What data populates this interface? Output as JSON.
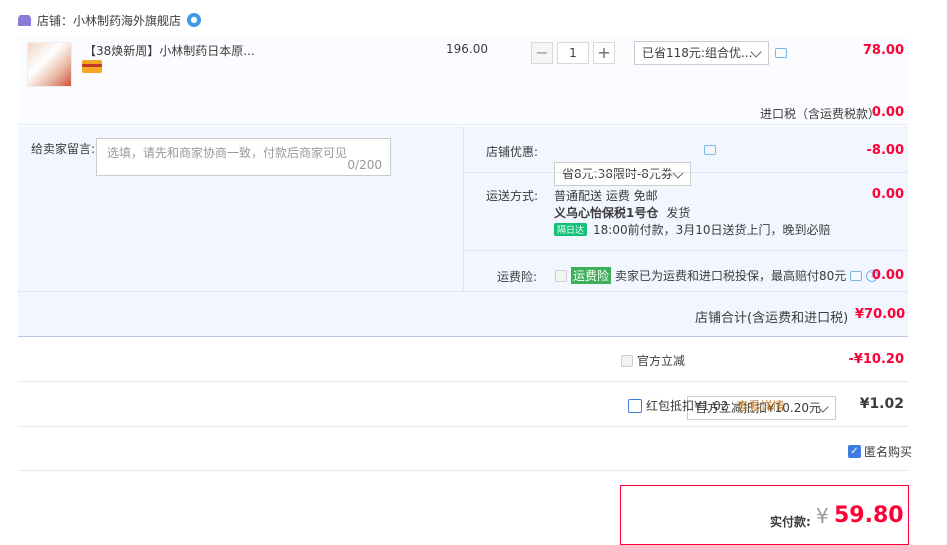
{
  "shop": {
    "label": "店铺：小林制药海外旗舰店"
  },
  "item": {
    "title": "【38焕新周】小林制药日本原...",
    "unit_price": "196.00",
    "quantity": "1",
    "promo_select": "已省118元:组合优...",
    "amount": "78.00"
  },
  "import_tax": {
    "label": "进口税（含运费税款）",
    "amount": "0.00"
  },
  "message": {
    "label": "给卖家留言:",
    "placeholder": "选填，请先和商家协商一致，付款后商家可见",
    "counter": "0/200"
  },
  "shop_discount": {
    "label": "店铺优惠:",
    "select": "省8元:38限时-8元券",
    "amount": "-8.00"
  },
  "shipping": {
    "label": "运送方式:",
    "method": "普通配送 运费 免邮",
    "warehouse": "义乌心怡保税1号仓",
    "ship_text": "发货",
    "tag": "隔日达",
    "eta": "18:00前付款，3月10日送货上门，晚到必赔",
    "amount": "0.00"
  },
  "insurance": {
    "label": "运费险:",
    "tag": "运费险",
    "text": "卖家已为运费和进口税投保，最高赔付80元",
    "amount": "0.00"
  },
  "shop_total": {
    "label": "店铺合计(含运费和进口税)",
    "amount": "¥70.00"
  },
  "official_discount": {
    "label": "官方立减",
    "select": "官方立减抵扣¥10.20元",
    "amount": "-¥10.20"
  },
  "red_packet": {
    "label": "红包抵扣¥1.02",
    "link": "查看详情",
    "amount": "¥1.02"
  },
  "anonymous": {
    "label": "匿名购买"
  },
  "payment": {
    "label": "实付款:",
    "currency": "¥",
    "amount": "59.80"
  },
  "colors": {
    "accent_red": "#ff0036",
    "link_blue": "#3e7ce0",
    "panel_bg": "#f2f7ff"
  }
}
